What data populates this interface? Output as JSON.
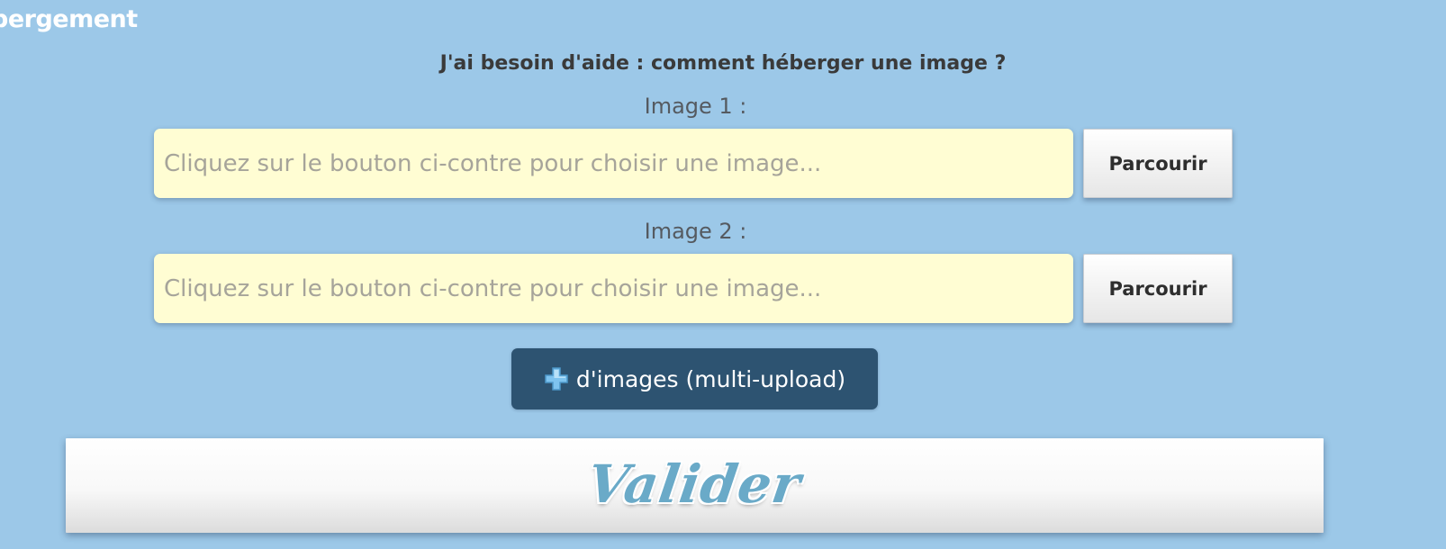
{
  "header": {
    "section_title": "bergement"
  },
  "help": {
    "link_text": "J'ai besoin d'aide : comment héberger une image ?"
  },
  "uploads": [
    {
      "label": "Image 1 :",
      "placeholder": "Cliquez sur le bouton ci-contre pour choisir une image...",
      "value": "",
      "browse_label": "Parcourir"
    },
    {
      "label": "Image 2 :",
      "placeholder": "Cliquez sur le bouton ci-contre pour choisir une image...",
      "value": "",
      "browse_label": "Parcourir"
    }
  ],
  "multi_upload": {
    "icon": "plus-icon",
    "label": "d'images (multi-upload)"
  },
  "submit": {
    "label": "Valider"
  },
  "colors": {
    "background": "#9cc8e8",
    "field_background": "#fffdd3",
    "multi_button": "#2d5371",
    "validate_text": "#6aaac8",
    "plus_icon": "#7ec3ef"
  }
}
